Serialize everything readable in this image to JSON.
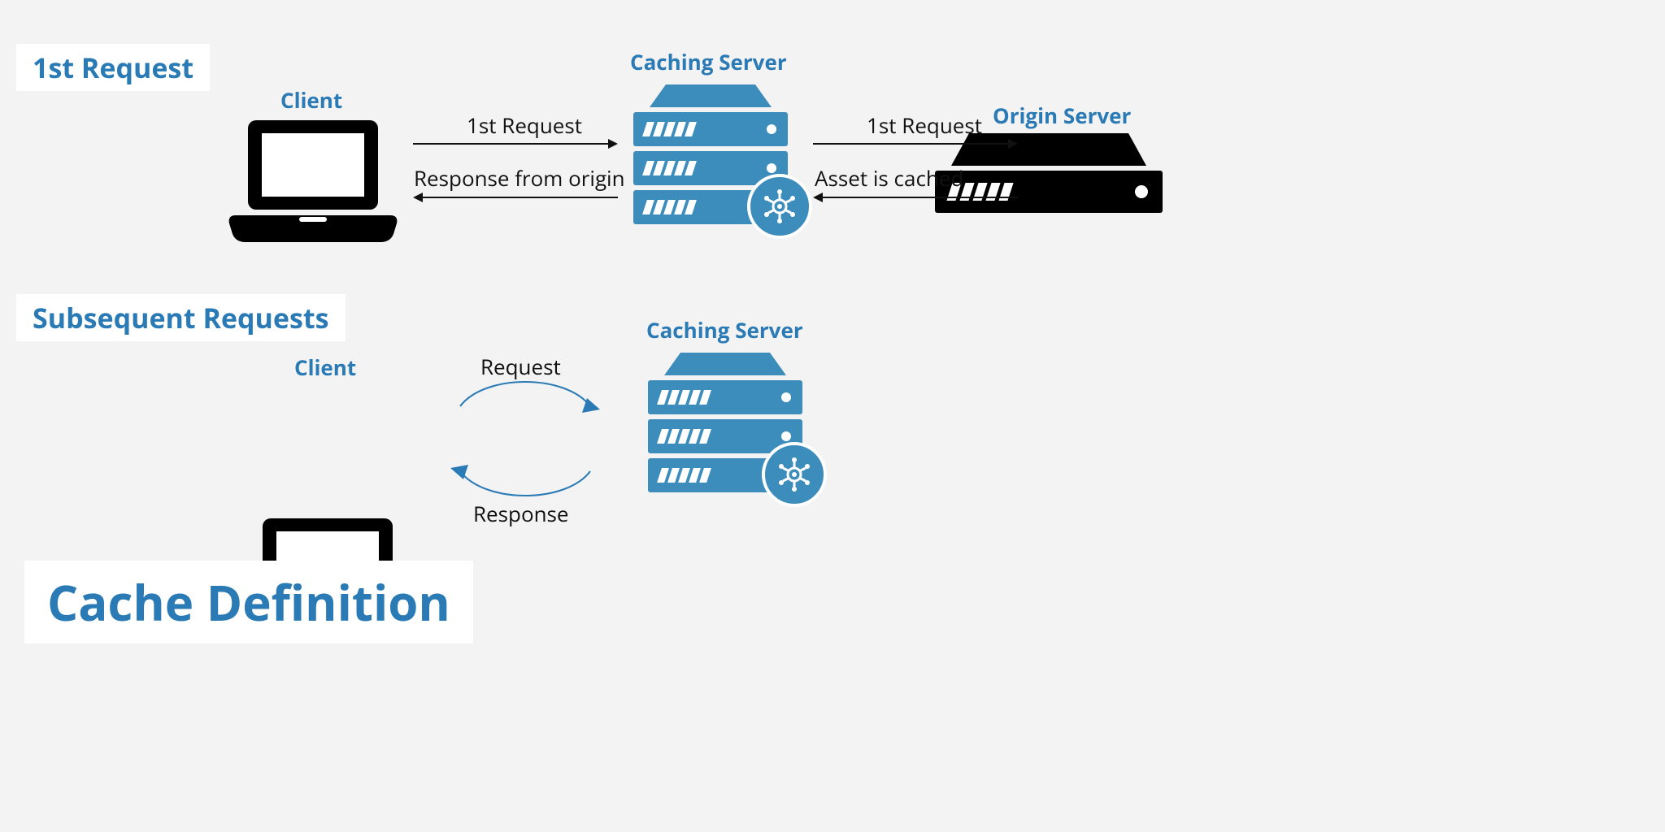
{
  "title": "Cache Definition",
  "sections": {
    "first": "1st Request",
    "subsequent": "Subsequent Requests"
  },
  "nodes": {
    "client": "Client",
    "caching_server": "Caching Server",
    "origin_server": "Origin Server"
  },
  "flows": {
    "first": {
      "client_to_cache": "1st Request",
      "cache_to_client": "Response from origin",
      "cache_to_origin": "1st Request",
      "origin_to_cache": "Asset is cached"
    },
    "subsequent": {
      "request": "Request",
      "response": "Response"
    }
  },
  "colors": {
    "accent_blue": "#2a7ab5",
    "server_blue": "#3c8dbc",
    "ink": "#111111",
    "bg": "#f3f3f3"
  }
}
